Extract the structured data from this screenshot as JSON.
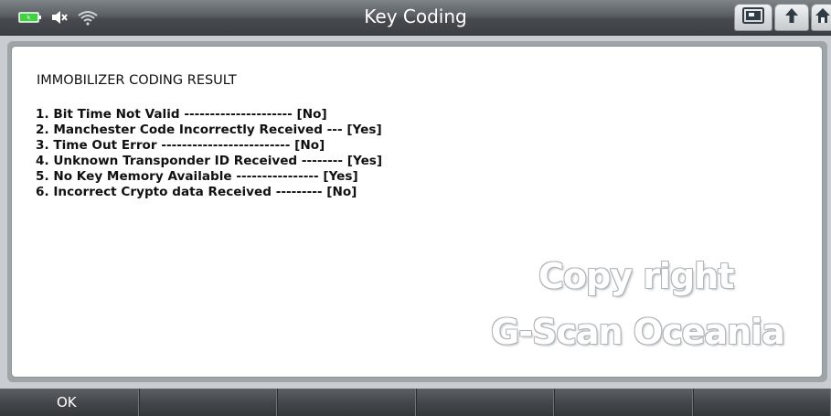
{
  "header": {
    "title": "Key Coding",
    "status_icons": [
      "battery-icon",
      "speaker-mute-icon",
      "wifi-icon"
    ],
    "buttons": [
      "screen-capture-icon",
      "back-icon",
      "home-icon"
    ]
  },
  "result": {
    "heading": "IMMOBILIZER CODING RESULT",
    "lines": [
      "1. Bit Time Not Valid --------------------- [No]",
      "2. Manchester Code Incorrectly Received --- [Yes]",
      "3. Time Out Error ------------------------- [No]",
      "4. Unknown Transponder ID Received -------- [Yes]",
      "5. No Key Memory Available ---------------- [Yes]",
      "6. Incorrect Crypto data Received --------- [No]"
    ]
  },
  "watermark": {
    "line1": "Copy right",
    "line2": "G-Scan Oceania"
  },
  "footer": {
    "buttons": [
      "OK",
      "",
      "",
      "",
      "",
      ""
    ]
  },
  "colors": {
    "battery": "#3fd13f",
    "titlebar": "#4a4e53",
    "panel": "#ffffff"
  }
}
